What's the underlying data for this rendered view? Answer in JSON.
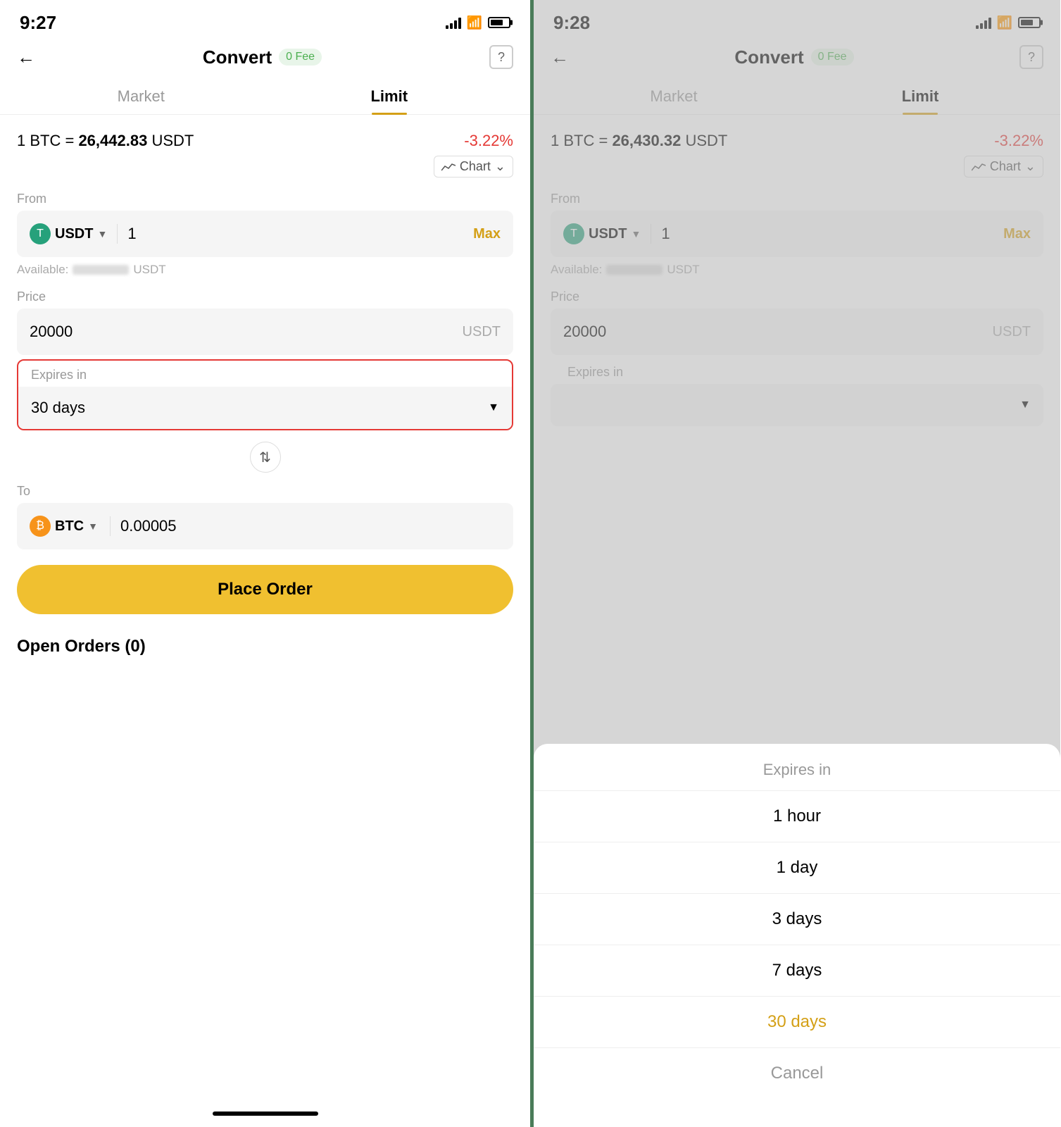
{
  "left_panel": {
    "status_time": "9:27",
    "header": {
      "title": "Convert",
      "fee_badge": "0 Fee",
      "help": "?"
    },
    "tabs": {
      "market": "Market",
      "limit": "Limit"
    },
    "rate": {
      "label": "1 BTC =",
      "value": "26,442.83",
      "unit": "USDT",
      "change": "-3.22%"
    },
    "chart_label": "Chart",
    "from_label": "From",
    "from": {
      "currency": "USDT",
      "value": "1",
      "max": "Max",
      "available_prefix": "Available:",
      "available_suffix": "USDT"
    },
    "price_label": "Price",
    "price": {
      "value": "20000",
      "suffix": "USDT"
    },
    "expires_label": "Expires in",
    "expires_value": "30 days",
    "to_label": "To",
    "to": {
      "currency": "BTC",
      "value": "0.00005"
    },
    "place_order": "Place Order",
    "open_orders": "Open Orders (0)"
  },
  "right_panel": {
    "status_time": "9:28",
    "header": {
      "title": "Convert",
      "fee_badge": "0 Fee",
      "help": "?"
    },
    "tabs": {
      "market": "Market",
      "limit": "Limit"
    },
    "rate": {
      "label": "1 BTC =",
      "value": "26,430.32",
      "unit": "USDT",
      "change": "-3.22%"
    },
    "chart_label": "Chart",
    "from_label": "From",
    "from": {
      "currency": "USDT",
      "value": "1",
      "max": "Max",
      "available_prefix": "Available:",
      "available_suffix": "USDT"
    },
    "price_label": "Price",
    "price": {
      "value": "20000",
      "suffix": "USDT"
    },
    "expires_label": "Expires in",
    "picker": {
      "title": "Expires in",
      "options": [
        "1 hour",
        "1 day",
        "3 days",
        "7 days",
        "30 days",
        "Cancel"
      ],
      "selected": "30 days",
      "cancel": "Cancel"
    }
  }
}
